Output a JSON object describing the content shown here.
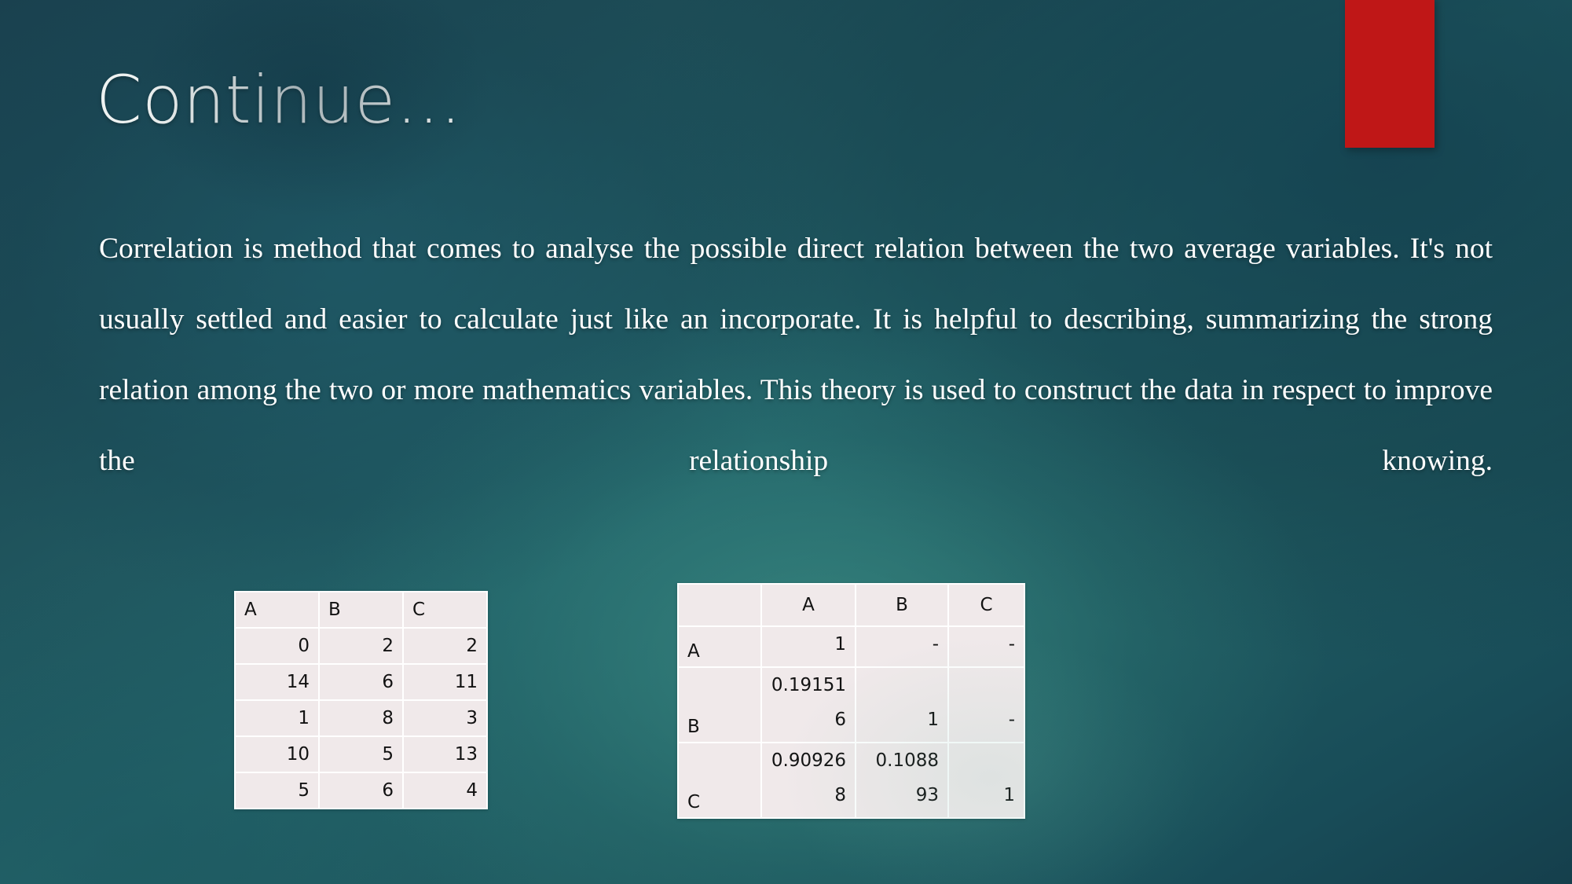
{
  "slide": {
    "title": "Continue…",
    "background_color": "#1f5a60",
    "accent_color": "#bf1717",
    "text_color": "#ffffff"
  },
  "body": {
    "paragraph": "Correlation is method that comes to analyse the possible direct relation between the two average variables. It's not usually settled and easier to calculate just like an incorporate. It is helpful to describing, summarizing the strong relation among the two or more mathematics variables. This theory is used to construct the data in respect to improve the relationship knowing."
  },
  "sample_table": {
    "headers": [
      "A",
      "B",
      "C"
    ],
    "rows": [
      [
        "0",
        "2",
        "2"
      ],
      [
        "14",
        "6",
        "11"
      ],
      [
        "1",
        "8",
        "3"
      ],
      [
        "10",
        "5",
        "13"
      ],
      [
        "5",
        "6",
        "4"
      ]
    ]
  },
  "correlation_table": {
    "corner_label": "",
    "headers": [
      "A",
      "B",
      "C"
    ],
    "rows": [
      {
        "label": "A",
        "values": [
          "1",
          "-",
          "-"
        ]
      },
      {
        "label": "B",
        "values": [
          "0.191516",
          "1",
          "-"
        ]
      },
      {
        "label": "C",
        "values": [
          "0.909268",
          "0.108893",
          "1"
        ]
      }
    ]
  },
  "chart_data": {
    "type": "table",
    "title": "Correlation matrix",
    "tables": [
      {
        "name": "sample-data",
        "columns": [
          "A",
          "B",
          "C"
        ],
        "rows": [
          [
            0,
            2,
            2
          ],
          [
            14,
            6,
            11
          ],
          [
            1,
            8,
            3
          ],
          [
            10,
            5,
            13
          ],
          [
            5,
            6,
            4
          ]
        ]
      },
      {
        "name": "correlation-matrix",
        "columns": [
          "",
          "A",
          "B",
          "C"
        ],
        "rows": [
          [
            "A",
            1,
            "-",
            "-"
          ],
          [
            "B",
            0.191516,
            1,
            "-"
          ],
          [
            "C",
            0.909268,
            0.108893,
            1
          ]
        ]
      }
    ]
  }
}
